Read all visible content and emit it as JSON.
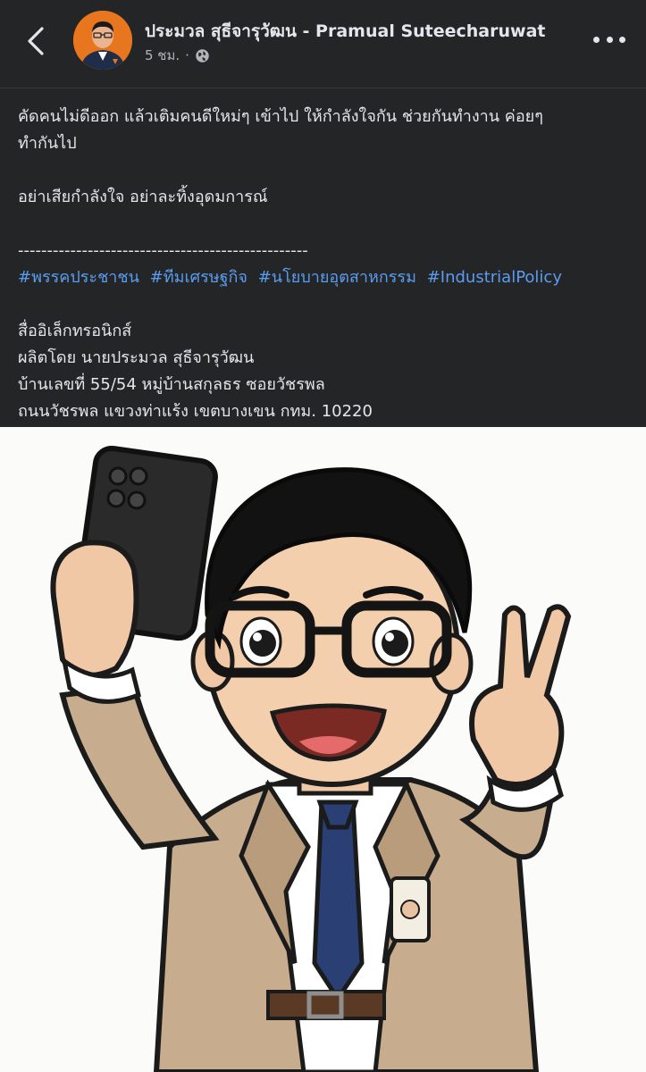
{
  "header": {
    "author_name": "ประมวล สุธีจารุวัฒน - Pramual Suteecharuwat",
    "time": "5 ชม.",
    "separator": "·",
    "back_icon": "chevron-left-icon",
    "privacy_icon": "globe-icon",
    "more_icon": "more-horizontal-icon"
  },
  "post": {
    "line1": "คัดคนไม่ดีออก แล้วเติมคนดีใหม่ๆ เข้าไป ให้กำลังใจกัน ช่วยกันทำงาน ค่อยๆ",
    "line2": "ทำกันไป",
    "line3": "อย่าเสียกำลังใจ อย่าละทิ้งอุดมการณ์",
    "separator_line": "--------------------------------------------------",
    "hashtags": [
      "#พรรคประชาชน",
      "#ทีมเศรษฐกิจ",
      "#นโยบายอุตสาหกรรม",
      "#IndustrialPolicy"
    ],
    "footer1": "สื่ออิเล็กทรอนิกส์",
    "footer2": "ผลิตโดย นายประมวล สุธีจารุวัฒน",
    "footer3": "บ้านเลขที่ 55/54 หมู่บ้านสกุลธร ซอยวัชรพล",
    "footer4": "ถนนวัชรพล แขวงท่าแร้ง เขตบางเขน กทม. 10220"
  },
  "colors": {
    "background": "#242526",
    "text": "#e4e6eb",
    "secondary_text": "#b0b3b8",
    "hashtag": "#5b9cf0",
    "image_background": "#fbfbf9"
  }
}
